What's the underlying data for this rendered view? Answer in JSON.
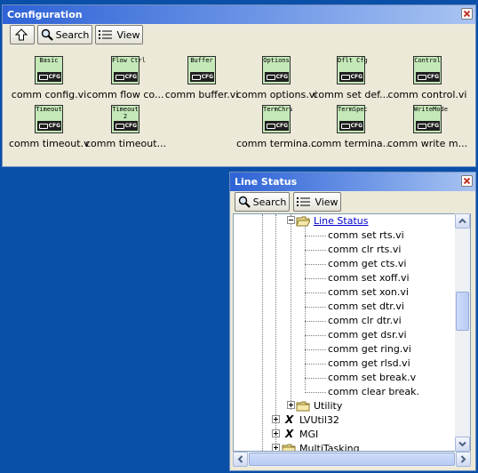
{
  "config_window": {
    "title": "Configuration",
    "toolbar": {
      "up_label": "",
      "search_label": "Search",
      "view_label": "View"
    },
    "items": [
      {
        "icon_text": "Basic",
        "name": "comm config.vi"
      },
      {
        "icon_text": "Flow Ctrl",
        "name": "comm flow co..."
      },
      {
        "icon_text": "Buffer",
        "name": "comm buffer.vi"
      },
      {
        "icon_text": "Options",
        "name": "comm options.vi"
      },
      {
        "icon_text": "Dflt Cfg",
        "name": "comm set def..."
      },
      {
        "icon_text": "Control",
        "name": "comm control.vi"
      },
      {
        "icon_text": "Timeout",
        "name": "comm timeout.vi"
      },
      {
        "icon_text": "Timeout\n2",
        "name": "comm timeout..."
      },
      {
        "icon_text": "TermChrs",
        "name": "comm termina..."
      },
      {
        "icon_text": "TermSpec",
        "name": "comm termina..."
      },
      {
        "icon_text": "WriteMode",
        "name": "comm write m..."
      }
    ],
    "icon_badge": "CFG"
  },
  "line_window": {
    "title": "Line Status",
    "toolbar": {
      "search_label": "Search",
      "view_label": "View"
    },
    "tree": {
      "open_folder": "Line Status",
      "children": [
        "comm set rts.vi",
        "comm clr rts.vi",
        "comm get cts.vi",
        "comm set xoff.vi",
        "comm set xon.vi",
        "comm set dtr.vi",
        "comm clr dtr.vi",
        "comm get dsr.vi",
        "comm get ring.vi",
        "comm get rlsd.vi",
        "comm set break.v",
        "comm clear break."
      ],
      "utility": "Utility",
      "lvutil": "LVUtil32",
      "mgi": "MGI",
      "multitasking": "MultiTasking"
    }
  },
  "colors": {
    "titlebar": "#2e62d6",
    "desktop": "#0a4fa8",
    "icon_bg": "#c4e8b8",
    "link": "#0000cc"
  }
}
